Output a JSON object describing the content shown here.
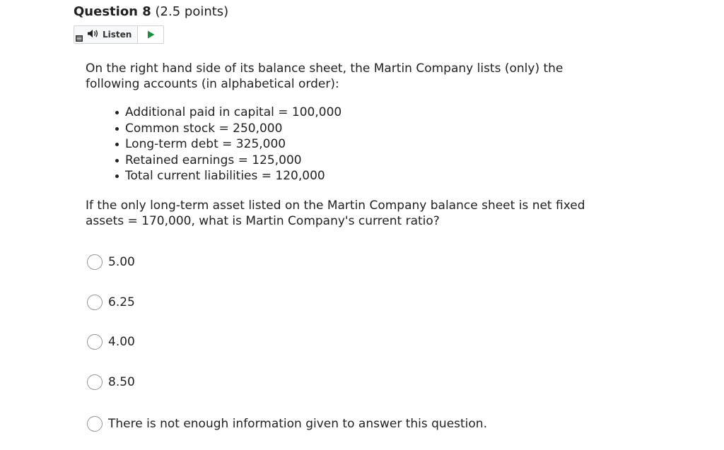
{
  "question": {
    "title": "Question 8",
    "points": "(2.5 points)"
  },
  "listen": {
    "label": "Listen",
    "icons": {
      "menu": "menu-icon",
      "speaker": "speaker-icon",
      "play": "play-icon"
    },
    "play_color": "#1a8f3c"
  },
  "stem": {
    "intro": "On the right hand side of its balance sheet, the Martin Company lists (only) the following accounts (in alphabetical order):",
    "accounts": [
      "Additional paid in capital = 100,000",
      "Common stock = 250,000",
      "Long-term debt = 325,000",
      "Retained earnings = 125,000",
      "Total current liabilities = 120,000"
    ],
    "question": "If the only long-term asset listed on the Martin Company balance sheet is net fixed assets = 170,000, what is Martin Company's current ratio?"
  },
  "choices": [
    "5.00",
    "6.25",
    "4.00",
    "8.50",
    "There is not enough information given to answer this question."
  ]
}
